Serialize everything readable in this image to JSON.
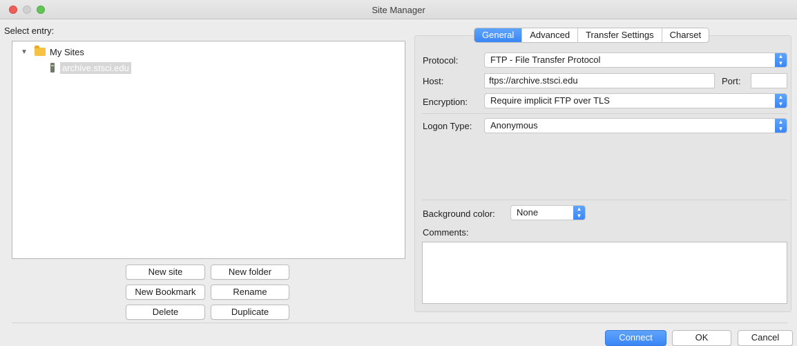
{
  "window": {
    "title": "Site Manager"
  },
  "left": {
    "select_entry_label": "Select entry:",
    "tree": {
      "folder": "My Sites",
      "site": "archive.stsci.edu"
    },
    "buttons": {
      "new_site": "New site",
      "new_folder": "New folder",
      "new_bookmark": "New Bookmark",
      "rename": "Rename",
      "delete": "Delete",
      "duplicate": "Duplicate"
    }
  },
  "tabs": [
    "General",
    "Advanced",
    "Transfer Settings",
    "Charset"
  ],
  "general": {
    "protocol_label": "Protocol:",
    "protocol_value": "FTP - File Transfer Protocol",
    "host_label": "Host:",
    "host_value": "ftps://archive.stsci.edu",
    "port_label": "Port:",
    "port_value": "",
    "encryption_label": "Encryption:",
    "encryption_value": "Require implicit FTP over TLS",
    "logon_type_label": "Logon Type:",
    "logon_type_value": "Anonymous",
    "background_color_label": "Background color:",
    "background_color_value": "None",
    "comments_label": "Comments:",
    "comments_value": ""
  },
  "footer": {
    "connect": "Connect",
    "ok": "OK",
    "cancel": "Cancel"
  },
  "colors": {
    "accent": "#3a86f6",
    "close": "#ee5f58",
    "maximize": "#61c554",
    "folder": "#f7c144"
  },
  "icons": {
    "folder": "folder-icon",
    "site": "server-icon",
    "disclosure": "disclosure-triangle-icon",
    "popup": "popup-arrows-icon"
  }
}
